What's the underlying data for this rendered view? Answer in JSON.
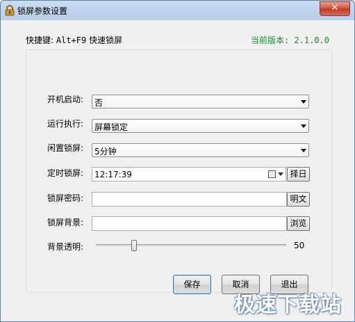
{
  "window": {
    "title": "锁屏参数设置",
    "close_symbol": "✕"
  },
  "header": {
    "shortcut_prefix": "快捷键:",
    "shortcut_keys": "Alt+F9",
    "shortcut_action": "快速锁屏",
    "version": "当前版本: 2.1.0.0",
    "version_color": "#1d8a2e"
  },
  "form": {
    "startup": {
      "label": "开机启动:",
      "value": "否"
    },
    "action": {
      "label": "运行执行:",
      "value": "屏幕锁定"
    },
    "idle": {
      "label": "闲置锁屏:",
      "value": "5分钟"
    },
    "timer": {
      "label": "定时锁屏:",
      "value": "12:17:39",
      "button": "择日"
    },
    "password": {
      "label": "锁屏密码:",
      "value": "",
      "button": "明文"
    },
    "background": {
      "label": "锁屏背景:",
      "value": "",
      "button": "浏览"
    },
    "opacity": {
      "label": "背景透明:",
      "value": "50",
      "level_percent": 20
    }
  },
  "buttons": {
    "save": "保存",
    "cancel": "取消",
    "exit": "退出"
  },
  "watermark": "极速下载站"
}
